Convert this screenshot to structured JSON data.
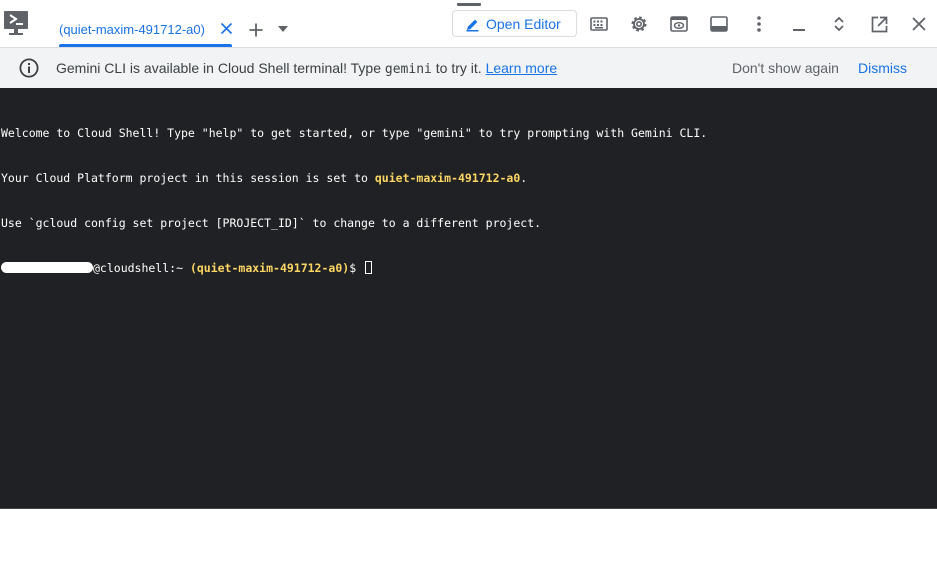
{
  "toolbar": {
    "tab_label": "(quiet-maxim-491712-a0)",
    "open_editor_label": "Open Editor",
    "icons": [
      "cloud-shell-logo",
      "close-icon",
      "plus-icon",
      "caret-down-icon",
      "pencil-icon",
      "keyboard-icon",
      "gear-icon",
      "web-preview-icon",
      "panel-icon",
      "more-vert-icon",
      "minimize-icon",
      "expand-icon",
      "open-new-window-icon",
      "close-icon"
    ]
  },
  "banner": {
    "text_before": "Gemini CLI is available in Cloud Shell terminal! Type ",
    "command": "gemini",
    "text_after": " to try it. ",
    "link": "Learn more",
    "dont_show": "Don't show again",
    "dismiss": "Dismiss"
  },
  "terminal": {
    "line1": "Welcome to Cloud Shell! Type \"help\" to get started, or type \"gemini\" to try prompting with Gemini CLI.",
    "line2_prefix": "Your Cloud Platform project in this session is set to ",
    "project_id": "quiet-maxim-491712-a0",
    "line2_suffix": ".",
    "line3": "Use `gcloud config set project [PROJECT_ID]` to change to a different project.",
    "prompt_host": "@cloudshell:~ ",
    "prompt_project": "(quiet-maxim-491712-a0)",
    "prompt_symbol": "$ "
  },
  "colors": {
    "accent": "#1a73e8",
    "terminal_bg": "#202124",
    "highlight": "#fdd663",
    "banner_bg": "#f1f3f4"
  }
}
